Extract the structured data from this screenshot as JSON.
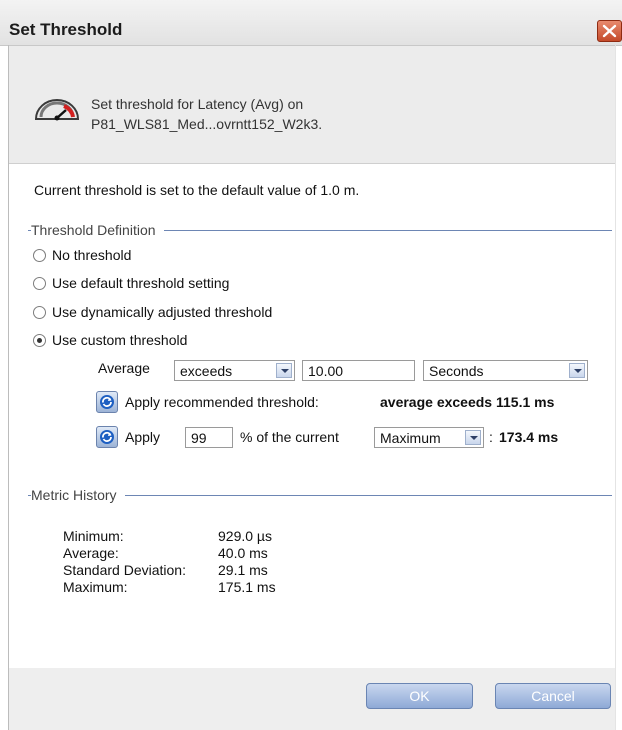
{
  "window": {
    "title": "Set Threshold",
    "close_label": ""
  },
  "header": {
    "line1": "Set threshold for Latency (Avg) on",
    "line2": "P81_WLS81_Med...ovrntt152_W2k3.",
    "icon": "gauge-icon"
  },
  "current_threshold_text": "Current threshold is set to the default value of 1.0 m.",
  "threshold_definition": {
    "title": "Threshold Definition",
    "options": [
      {
        "label": "No threshold",
        "selected": false
      },
      {
        "label": "Use default threshold setting",
        "selected": false
      },
      {
        "label": "Use dynamically adjusted threshold",
        "selected": false
      },
      {
        "label": "Use custom threshold",
        "selected": true
      }
    ],
    "average_label": "Average",
    "comparison_value": "exceeds",
    "threshold_value": "10.00",
    "unit_value": "Seconds",
    "recommended": {
      "text": "Apply recommended threshold:",
      "value": "average exceeds 115.1 ms"
    },
    "percent": {
      "apply_text": "Apply",
      "value": "99",
      "of_text": "% of the current",
      "basis_value": "Maximum",
      "colon": ":",
      "result": "173.4 ms"
    }
  },
  "metric_history": {
    "title": "Metric History",
    "rows": [
      {
        "label": "Minimum:",
        "value": "929.0 µs"
      },
      {
        "label": "Average:",
        "value": "40.0 ms"
      },
      {
        "label": "Standard Deviation:",
        "value": "29.1 ms"
      },
      {
        "label": "Maximum:",
        "value": "175.1 ms"
      }
    ]
  },
  "buttons": {
    "ok": "OK",
    "cancel": "Cancel"
  },
  "colors": {
    "section_line": "#6d86b4",
    "button": "#8ea9d6",
    "close": "#c44a2a"
  }
}
